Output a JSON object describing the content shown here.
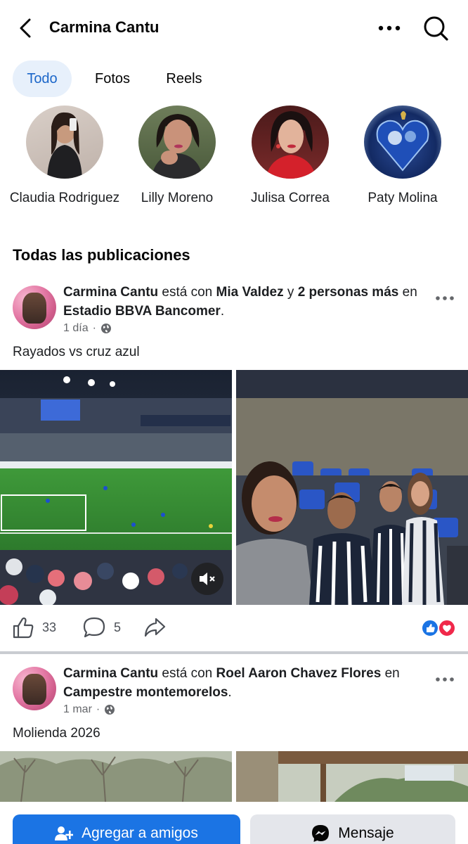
{
  "header": {
    "title": "Carmina Cantu"
  },
  "tabs": [
    {
      "label": "Todo",
      "active": true
    },
    {
      "label": "Fotos",
      "active": false
    },
    {
      "label": "Reels",
      "active": false
    }
  ],
  "friends": [
    {
      "name": "Claudia Rodriguez"
    },
    {
      "name": "Lilly Moreno"
    },
    {
      "name": "Julisa Correa"
    },
    {
      "name": "Paty Molina"
    }
  ],
  "section_title": "Todas las publicaciones",
  "posts": [
    {
      "author": "Carmina Cantu",
      "with_text": "está con",
      "tagged": "Mia Valdez",
      "and_text": "y",
      "others": "2 personas más",
      "in_text": "en",
      "place": "Estadio BBVA Bancomer",
      "period": ".",
      "time": "1 día",
      "caption": "Rayados vs cruz azul",
      "likes": "33",
      "comments": "5"
    },
    {
      "author": "Carmina Cantu",
      "with_text": "está con",
      "tagged": "Roel Aaron Chavez Flores",
      "in_text": "en",
      "place": "Campestre montemorelos",
      "period": ".",
      "time": "1 mar",
      "caption": "Molienda 2026"
    }
  ],
  "bottom": {
    "add_label": "Agregar a amigos",
    "message_label": "Mensaje"
  },
  "colors": {
    "accent": "#1b74e4",
    "tab_active_bg": "#e7f0fb",
    "tab_active_text": "#1b66c9",
    "like_blue": "#1b74e4",
    "love_red": "#f0284a"
  }
}
